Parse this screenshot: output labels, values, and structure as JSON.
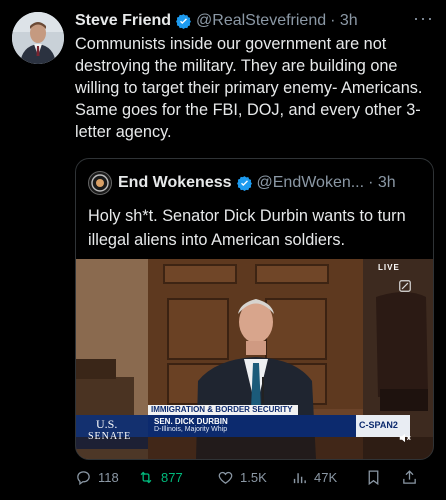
{
  "tweet": {
    "author_name": "Steve Friend",
    "author_handle": "@RealStevefriend",
    "time": "· 3h",
    "more": "···",
    "text": "Communists inside our government are not destroying the military. They are building one willing to target their primary enemy- Americans. Same goes for the FBI, DOJ, and every other 3-letter agency."
  },
  "quote": {
    "author_name": "End Wokeness",
    "author_handle": "@EndWoken...",
    "time": "· 3h",
    "text": "Holy sh*t. Senator Dick Durbin wants to turn illegal aliens into American soldiers.",
    "video": {
      "live_badge": "LIVE",
      "topic_banner": "IMMIGRATION & BORDER SECURITY",
      "speaker_name": "SEN. DICK DURBIN",
      "speaker_title": "D-Illinois, Majority Whip",
      "chamber_line1": "U.S.",
      "chamber_line2": "SENATE",
      "network": "C-SPAN2"
    }
  },
  "actions": {
    "replies": "118",
    "reposts": "877",
    "likes": "1.5K",
    "views": "47K"
  },
  "colors": {
    "verified": "#1d9bf0",
    "repost_green": "#00ba7c",
    "muted": "#8b98a5",
    "border": "#2f3336"
  }
}
